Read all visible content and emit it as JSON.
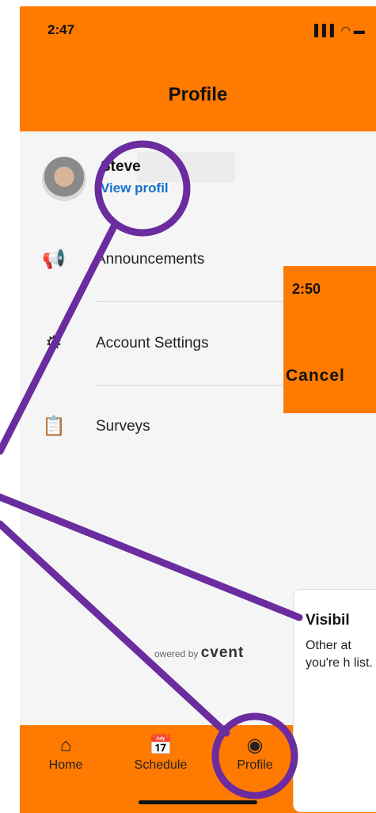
{
  "status_bar": {
    "time": "2:47",
    "icons": "▌▌▌ ◠ ▬"
  },
  "header": {
    "title": "Profile"
  },
  "profile": {
    "name": "Steve",
    "view_profile": "View profil"
  },
  "menu": {
    "items": [
      {
        "label": "Announcements",
        "icon": "megaphone-icon",
        "glyph": "📢"
      },
      {
        "label": "Account Settings",
        "icon": "gear-icon",
        "glyph": "⚙"
      },
      {
        "label": "Surveys",
        "icon": "survey-icon",
        "glyph": "📋"
      }
    ]
  },
  "footer": {
    "powered_by": "owered by",
    "brand": "cvent"
  },
  "tabbar": {
    "tabs": [
      {
        "label": "Home",
        "icon": "home-icon",
        "glyph": "⌂"
      },
      {
        "label": "Schedule",
        "icon": "calendar-icon",
        "glyph": "📅"
      },
      {
        "label": "Profile",
        "icon": "profile-icon",
        "glyph": "◉"
      }
    ]
  },
  "second_screen": {
    "time": "2:50",
    "cancel": "Cancel",
    "card_title": "Visibil",
    "card_body": "Other at you're h list."
  },
  "colors": {
    "brand_orange": "#ff7a00",
    "link_blue": "#1570d1",
    "annotation_purple": "#6a2c9e"
  }
}
